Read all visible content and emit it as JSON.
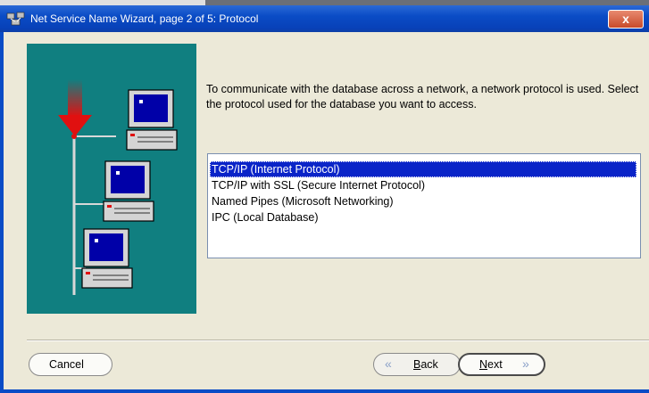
{
  "window": {
    "title": "Net Service Name Wizard, page 2 of 5: Protocol",
    "close_label": "x"
  },
  "content": {
    "description": "To communicate with the database across a network, a network protocol is used.  Select the protocol used for the database you want to access.",
    "protocols": [
      {
        "label": "TCP/IP (Internet Protocol)",
        "selected": true
      },
      {
        "label": "TCP/IP with SSL (Secure Internet Protocol)",
        "selected": false
      },
      {
        "label": "Named Pipes (Microsoft Networking)",
        "selected": false
      },
      {
        "label": "IPC (Local Database)",
        "selected": false
      }
    ]
  },
  "buttons": {
    "cancel": "Cancel",
    "back": "Back",
    "back_mnemonic": "B",
    "back_rest": "ack",
    "next": "Next",
    "next_mnemonic": "N",
    "next_rest": "ext"
  },
  "colors": {
    "titlebar": "#0a4cc6",
    "illustration_bg": "#107f80",
    "selection": "#0a24c8",
    "window_bg": "#ece9d8"
  },
  "icons": [
    "wizard-app-icon",
    "close-icon",
    "network-illustration",
    "back-arrow-icon",
    "next-arrow-icon"
  ]
}
